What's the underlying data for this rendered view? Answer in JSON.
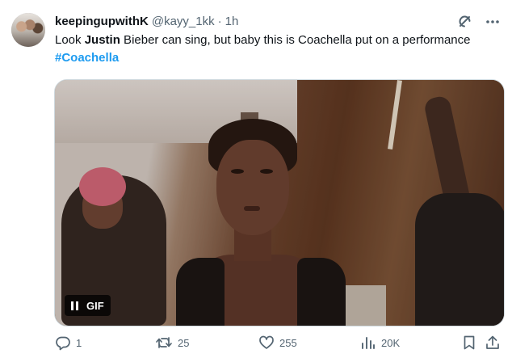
{
  "author": {
    "display_name": "keepingupwithK",
    "handle": "@kayy_1kk",
    "separator": "·",
    "time": "1h"
  },
  "tweet": {
    "text_prefix": "Look ",
    "text_bold": "Justin",
    "text_rest": " Bieber can sing, but baby this is Coachella put on a performance ",
    "hashtag": "#Coachella"
  },
  "media": {
    "type": "gif",
    "gif_label": "GIF",
    "control_icon": "pause-icon"
  },
  "actions": {
    "replies": "1",
    "retweets": "25",
    "likes": "255",
    "views": "20K"
  },
  "icons": {
    "header": [
      "grok-icon",
      "more-icon"
    ],
    "actions": [
      "reply-icon",
      "retweet-icon",
      "like-icon",
      "views-icon",
      "bookmark-icon",
      "share-icon"
    ]
  },
  "colors": {
    "text": "#0f1419",
    "secondary": "#536471",
    "accent": "#1d9bf0",
    "border": "#cfd9de"
  }
}
